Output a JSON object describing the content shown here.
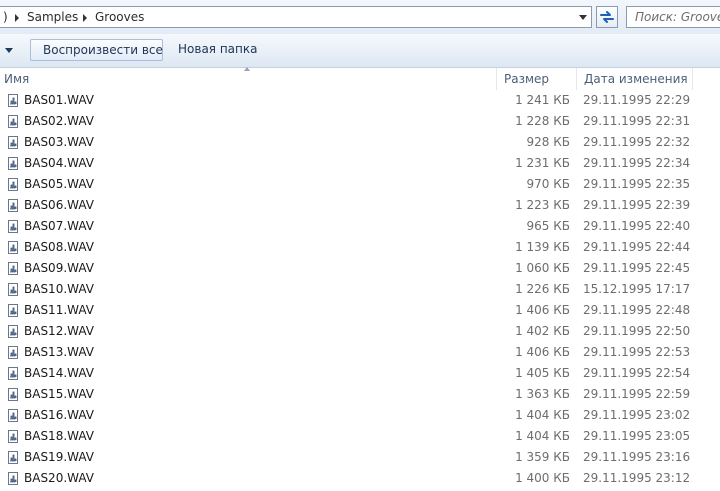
{
  "address_bar": {
    "path": [
      "Samples",
      "Grooves"
    ],
    "search_placeholder": "Поиск: Grooves"
  },
  "toolbar": {
    "play_all_label": "Воспроизвести все",
    "new_folder_label": "Новая папка"
  },
  "columns": {
    "name": "Имя",
    "size": "Размер",
    "date": "Дата изменения"
  },
  "files": [
    {
      "name": "BAS01.WAV",
      "size": "1 241 КБ",
      "date": "29.11.1995 22:29"
    },
    {
      "name": "BAS02.WAV",
      "size": "1 228 КБ",
      "date": "29.11.1995 22:31"
    },
    {
      "name": "BAS03.WAV",
      "size": "928 КБ",
      "date": "29.11.1995 22:32"
    },
    {
      "name": "BAS04.WAV",
      "size": "1 231 КБ",
      "date": "29.11.1995 22:34"
    },
    {
      "name": "BAS05.WAV",
      "size": "970 КБ",
      "date": "29.11.1995 22:35"
    },
    {
      "name": "BAS06.WAV",
      "size": "1 223 КБ",
      "date": "29.11.1995 22:39"
    },
    {
      "name": "BAS07.WAV",
      "size": "965 КБ",
      "date": "29.11.1995 22:40"
    },
    {
      "name": "BAS08.WAV",
      "size": "1 139 КБ",
      "date": "29.11.1995 22:44"
    },
    {
      "name": "BAS09.WAV",
      "size": "1 060 КБ",
      "date": "29.11.1995 22:45"
    },
    {
      "name": "BAS10.WAV",
      "size": "1 226 КБ",
      "date": "15.12.1995 17:17"
    },
    {
      "name": "BAS11.WAV",
      "size": "1 406 КБ",
      "date": "29.11.1995 22:48"
    },
    {
      "name": "BAS12.WAV",
      "size": "1 402 КБ",
      "date": "29.11.1995 22:50"
    },
    {
      "name": "BAS13.WAV",
      "size": "1 406 КБ",
      "date": "29.11.1995 22:53"
    },
    {
      "name": "BAS14.WAV",
      "size": "1 405 КБ",
      "date": "29.11.1995 22:54"
    },
    {
      "name": "BAS15.WAV",
      "size": "1 363 КБ",
      "date": "29.11.1995 22:59"
    },
    {
      "name": "BAS16.WAV",
      "size": "1 404 КБ",
      "date": "29.11.1995 23:02"
    },
    {
      "name": "BAS18.WAV",
      "size": "1 404 КБ",
      "date": "29.11.1995 23:05"
    },
    {
      "name": "BAS19.WAV",
      "size": "1 359 КБ",
      "date": "29.11.1995 23:16"
    },
    {
      "name": "BAS20.WAV",
      "size": "1 400 КБ",
      "date": "29.11.1995 23:12"
    }
  ],
  "icons": {
    "file": "wav-file-icon",
    "refresh": "refresh-icon",
    "path_separator": "chevron-right-icon"
  }
}
